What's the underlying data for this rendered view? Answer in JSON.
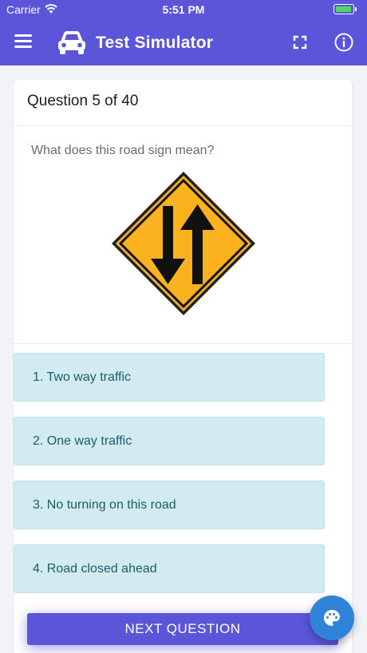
{
  "status_bar": {
    "carrier": "Carrier",
    "time": "5:51 PM"
  },
  "nav": {
    "title": "Test Simulator",
    "icons": [
      "menu-icon",
      "car-icon",
      "fullscreen-icon",
      "info-icon"
    ]
  },
  "question": {
    "header": "Question 5 of 40",
    "text": "What does this road sign mean?",
    "sign": "two-way-traffic-sign"
  },
  "options": [
    {
      "label": "1. Two way traffic"
    },
    {
      "label": "2. One way traffic"
    },
    {
      "label": "3. No turning on this road"
    },
    {
      "label": "4. Road closed ahead"
    }
  ],
  "next_button": {
    "label": "NEXT QUESTION"
  },
  "fab": {
    "icon": "palette-icon"
  },
  "colors": {
    "header": "#5a55d9",
    "option_bg": "#d1ebf0",
    "option_text": "#1d5b68",
    "fab": "#2f84d9",
    "sign_yellow": "#fbb21f"
  }
}
